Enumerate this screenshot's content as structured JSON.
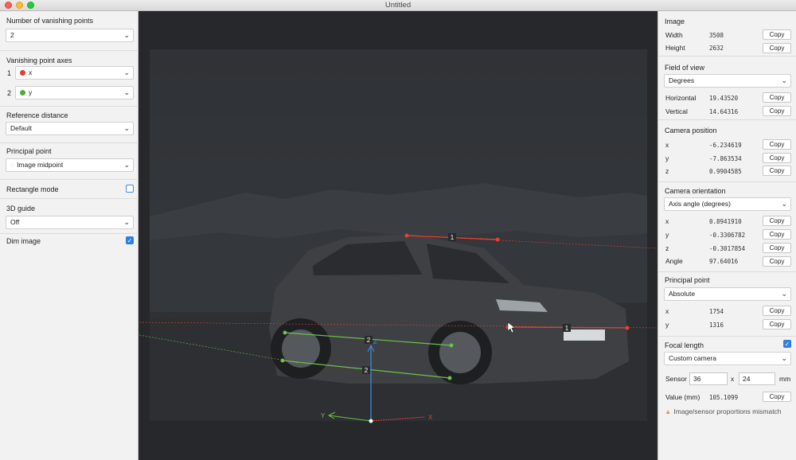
{
  "window": {
    "title": "Untitled"
  },
  "left": {
    "vp_count": {
      "label": "Number of vanishing points",
      "value": "2"
    },
    "vp_axes": {
      "label": "Vanishing point axes",
      "items": [
        {
          "num": "1",
          "value": "x",
          "color": "#e0402a"
        },
        {
          "num": "2",
          "value": "y",
          "color": "#4caf3a"
        }
      ]
    },
    "ref_distance": {
      "label": "Reference distance",
      "value": "Default"
    },
    "principal_point": {
      "label": "Principal point",
      "value": "Image midpoint"
    },
    "rectangle_mode": {
      "label": "Rectangle mode",
      "checked": false
    },
    "guide": {
      "label": "3D guide",
      "value": "Off"
    },
    "dim_image": {
      "label": "Dim image",
      "checked": true
    }
  },
  "overlay": {
    "label_1a": "1",
    "label_1b": "1",
    "label_2a": "2",
    "label_2b": "2",
    "axis_x": "X",
    "axis_y": "Y",
    "axis_z": "Z",
    "colors": {
      "x": "#e8402f",
      "y": "#6cc14a",
      "z": "#3b8fe8"
    }
  },
  "right": {
    "copy_label": "Copy",
    "image": {
      "title": "Image",
      "width_label": "Width",
      "width": "3508",
      "height_label": "Height",
      "height": "2632"
    },
    "fov": {
      "title": "Field of view",
      "unit": "Degrees",
      "h_label": "Horizontal",
      "h": "19.43520",
      "v_label": "Vertical",
      "v": "14.64316"
    },
    "cam_pos": {
      "title": "Camera position",
      "rows": [
        {
          "k": "x",
          "v": "-6.234619"
        },
        {
          "k": "y",
          "v": "-7.863534"
        },
        {
          "k": "z",
          "v": "0.9904585"
        }
      ]
    },
    "cam_orient": {
      "title": "Camera orientation",
      "mode": "Axis angle (degrees)",
      "rows": [
        {
          "k": "x",
          "v": "0.8941910"
        },
        {
          "k": "y",
          "v": "-0.3306782"
        },
        {
          "k": "z",
          "v": "-0.3017854"
        },
        {
          "k": "Angle",
          "v": "97.64016"
        }
      ]
    },
    "pp": {
      "title": "Principal point",
      "mode": "Absolute",
      "rows": [
        {
          "k": "x",
          "v": "1754"
        },
        {
          "k": "y",
          "v": "1316"
        }
      ]
    },
    "focal": {
      "title": "Focal length",
      "checked": true,
      "camera": "Custom camera",
      "sensor_label": "Sensor",
      "sensor_w": "36",
      "sensor_x": "x",
      "sensor_h": "24",
      "sensor_unit": "mm",
      "value_label": "Value (mm)",
      "value": "105.1099",
      "warning": "Image/sensor proportions mismatch"
    }
  }
}
